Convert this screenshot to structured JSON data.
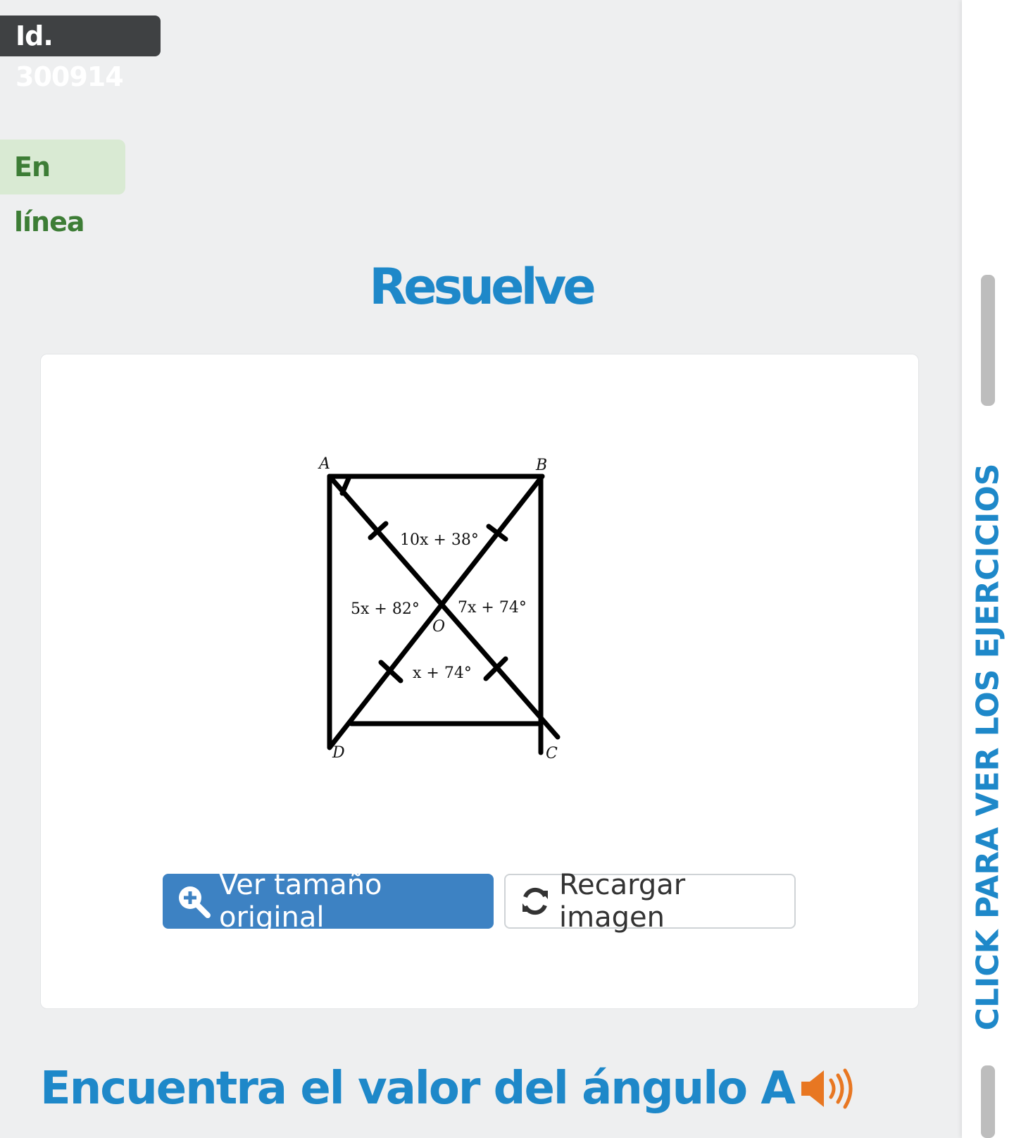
{
  "header": {
    "id_label": "Id. 300914",
    "status": "En línea"
  },
  "main": {
    "title": "Resuelve",
    "figure": {
      "vertices": [
        "A",
        "B",
        "C",
        "D"
      ],
      "center_label": "O",
      "angle_top": "10x + 38°",
      "angle_left": "5x + 82°",
      "angle_right": "7x + 74°",
      "angle_bottom": "x + 74°"
    },
    "buttons": {
      "view_original": "Ver tamaño original",
      "reload_image": "Recargar imagen"
    },
    "question": "Encuentra el valor del ángulo A"
  },
  "side_panel": {
    "label": "CLICK PARA VER LOS EJERCICIOS"
  },
  "colors": {
    "accent": "#1e88c9",
    "primary_button": "#3d82c3",
    "status_bg": "#d9ead3",
    "status_text": "#3d7d36",
    "speaker": "#e87722"
  },
  "icons": {
    "view_original": "zoom-in-icon",
    "reload_image": "refresh-icon",
    "question_audio": "speaker-icon"
  }
}
